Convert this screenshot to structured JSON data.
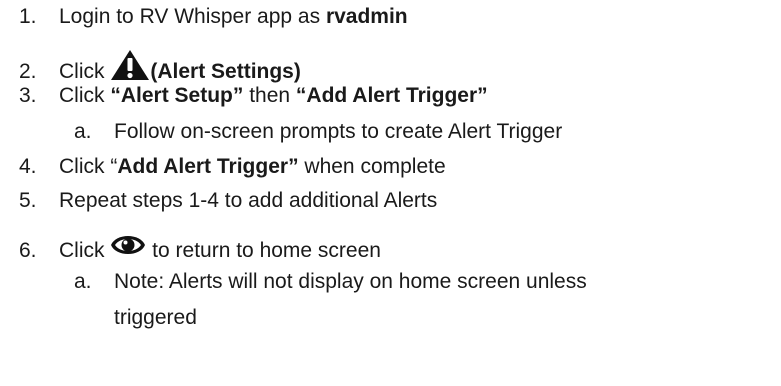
{
  "steps": [
    {
      "num": "1.",
      "pre": "Login to RV Whisper app as ",
      "bold": "rvadmin"
    },
    {
      "num": "2.",
      "pre": "Click ",
      "icon": "warning-triangle-icon",
      "bold": "(Alert Settings)"
    },
    {
      "num": "3.",
      "pre": "Click ",
      "bold1": "“Alert Setup”",
      "mid": " then ",
      "bold2": "“Add Alert Trigger”",
      "sub": {
        "num": "a.",
        "text": "Follow on-screen prompts to create Alert Trigger"
      }
    },
    {
      "num": "4.",
      "pre": "Click “",
      "bold": "Add Alert Trigger”",
      "post": " when complete"
    },
    {
      "num": "5.",
      "text": "Repeat steps 1-4 to add additional Alerts"
    },
    {
      "num": "6.",
      "pre": "Click ",
      "icon": "eye-icon",
      "post": " to return to home screen",
      "sub": {
        "num": "a.",
        "text": "Note: Alerts will not display on home screen unless",
        "text2": "triggered"
      }
    }
  ],
  "icons": {
    "warning": "warning-triangle-icon",
    "eye": "eye-icon"
  },
  "colors": {
    "text": "#1a1a1a"
  }
}
